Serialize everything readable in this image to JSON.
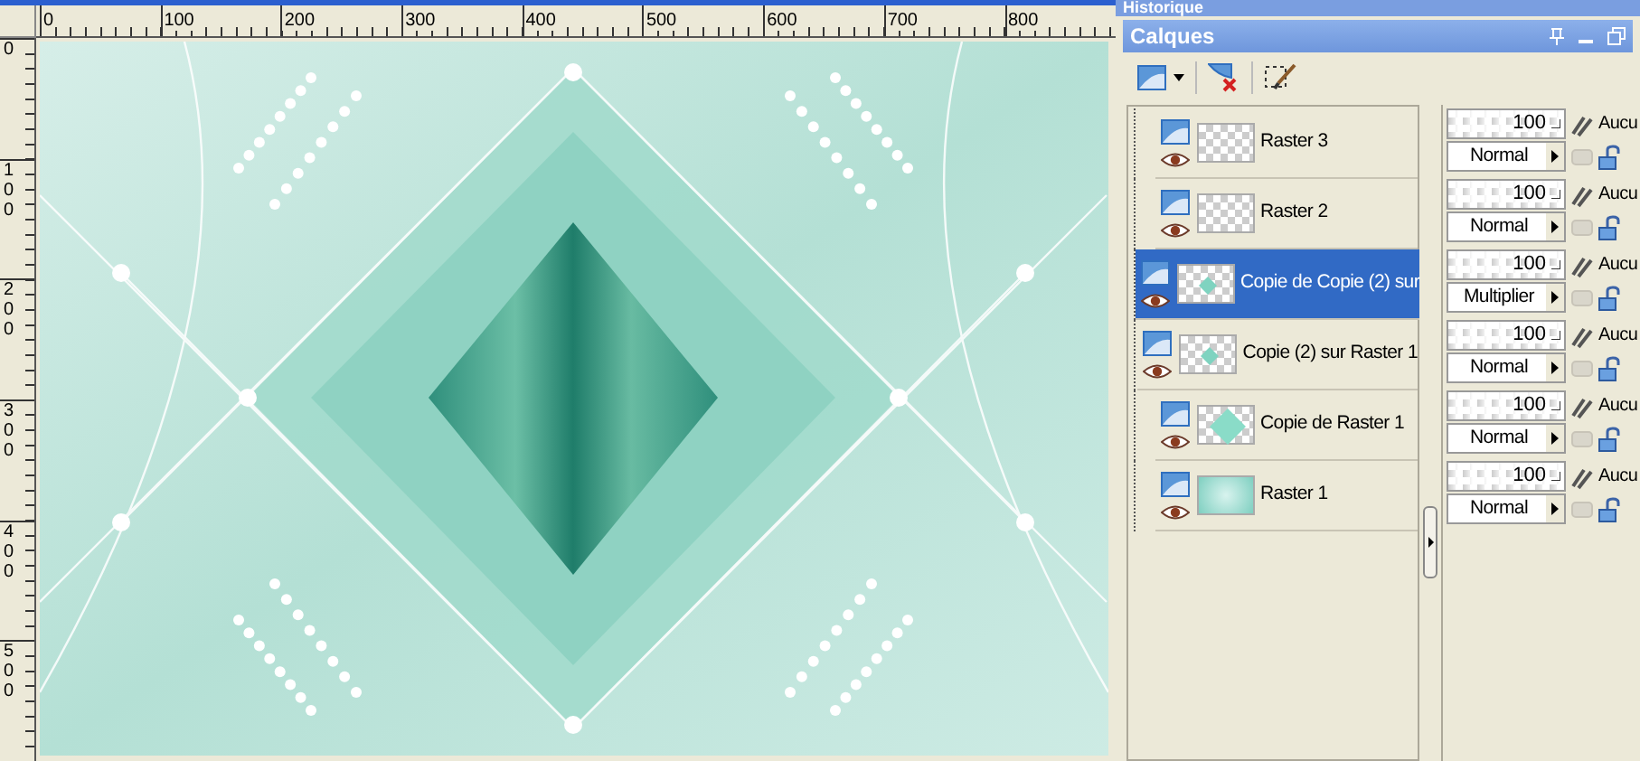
{
  "rulers": {
    "horizontal": [
      "0",
      "100",
      "200",
      "300",
      "400",
      "500",
      "600",
      "700",
      "800"
    ],
    "vertical": [
      "0",
      "100",
      "200",
      "300",
      "400",
      "500"
    ]
  },
  "history_panel": {
    "title": "Historique"
  },
  "layers_panel": {
    "title": "Calques"
  },
  "layers": [
    {
      "name": "Raster 3",
      "selected": false,
      "visible": true,
      "kind": "empty",
      "opacity": "100",
      "blend_mode": "Normal",
      "mask": "Aucu"
    },
    {
      "name": "Raster 2",
      "selected": false,
      "visible": true,
      "kind": "empty",
      "opacity": "100",
      "blend_mode": "Normal",
      "mask": "Aucu"
    },
    {
      "name": "Copie de Copie (2) sur",
      "selected": true,
      "visible": true,
      "kind": "small-diamond",
      "opacity": "100",
      "blend_mode": "Multiplier",
      "mask": "Aucu"
    },
    {
      "name": "Copie (2) sur Raster 1",
      "selected": false,
      "visible": true,
      "kind": "small-diamond",
      "opacity": "100",
      "blend_mode": "Normal",
      "mask": "Aucu"
    },
    {
      "name": "Copie de Raster 1",
      "selected": false,
      "visible": true,
      "kind": "large-diamond",
      "opacity": "100",
      "blend_mode": "Normal",
      "mask": "Aucu"
    },
    {
      "name": "Raster 1",
      "selected": false,
      "visible": true,
      "kind": "image",
      "opacity": "100",
      "blend_mode": "Normal",
      "mask": "Aucu"
    }
  ]
}
